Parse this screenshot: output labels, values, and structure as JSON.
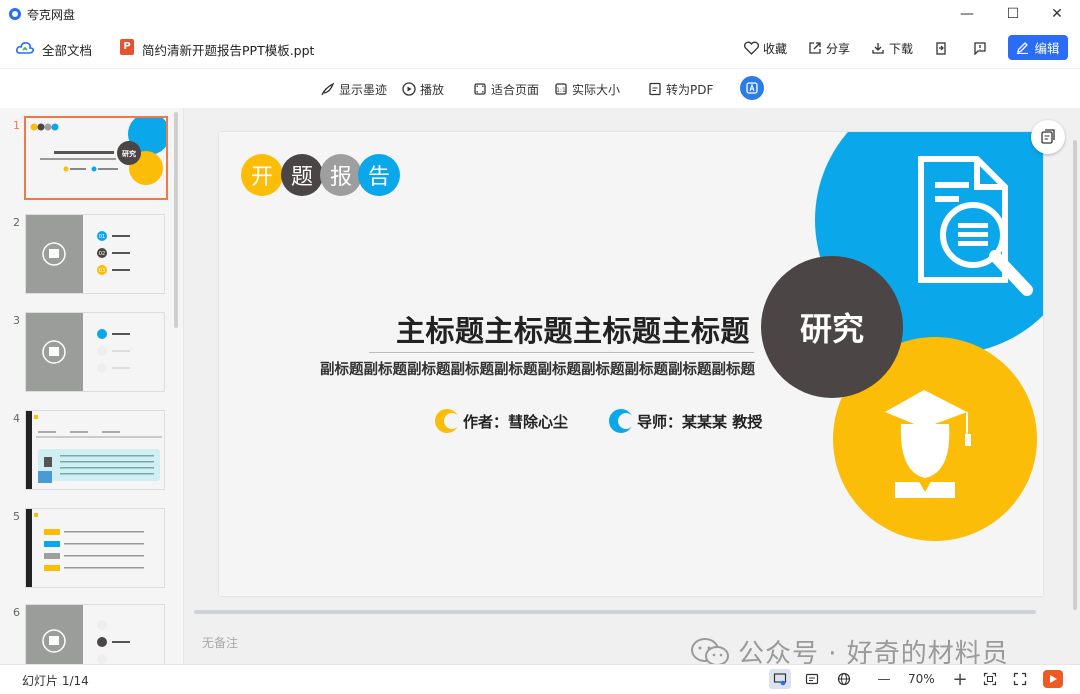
{
  "window": {
    "app_name": "夸克网盘",
    "controls": {
      "minimize": "—",
      "maximize": "☐",
      "close": "✕"
    }
  },
  "header": {
    "all_docs_label": "全部文档",
    "file_type_badge": "P",
    "file_name": "简约清新开题报告PPT模板.ppt",
    "favorite_label": "收藏",
    "share_label": "分享",
    "download_label": "下载",
    "edit_label": "编辑"
  },
  "toolbar": {
    "show_ink_label": "显示墨迹",
    "play_label": "播放",
    "fit_page_label": "适合页面",
    "actual_size_label": "实际大小",
    "to_pdf_label": "转为PDF"
  },
  "sidebar": {
    "thumbnails": [
      {
        "number": "1",
        "selected": true
      },
      {
        "number": "2",
        "selected": false
      },
      {
        "number": "3",
        "selected": false
      },
      {
        "number": "4",
        "selected": false
      },
      {
        "number": "5",
        "selected": false
      },
      {
        "number": "6",
        "selected": false
      }
    ],
    "thumb2": {
      "items": [
        "01",
        "02",
        "03"
      ]
    }
  },
  "slide": {
    "chips": [
      "开",
      "题",
      "报",
      "告"
    ],
    "chip_colors": [
      "#fbbd08",
      "#4b4546",
      "#9e9e9e",
      "#0aa8ea"
    ],
    "title": "主标题主标题主标题主标题",
    "subtitle": "副标题副标题副标题副标题副标题副标题副标题副标题副标题副标题",
    "author": "作者：彗除心尘",
    "advisor": "导师：某某某 教授",
    "center_badge": "研究",
    "colors": {
      "blue": "#0aa8ea",
      "yellow": "#fbbd08",
      "dark": "#4b4546"
    }
  },
  "notes": {
    "placeholder": "无备注"
  },
  "watermark": {
    "text": "公众号 · 好奇的材料员"
  },
  "status": {
    "slide_count": "幻灯片 1/14",
    "zoom_minus": "—",
    "zoom_level": "70%",
    "zoom_plus": "+"
  }
}
